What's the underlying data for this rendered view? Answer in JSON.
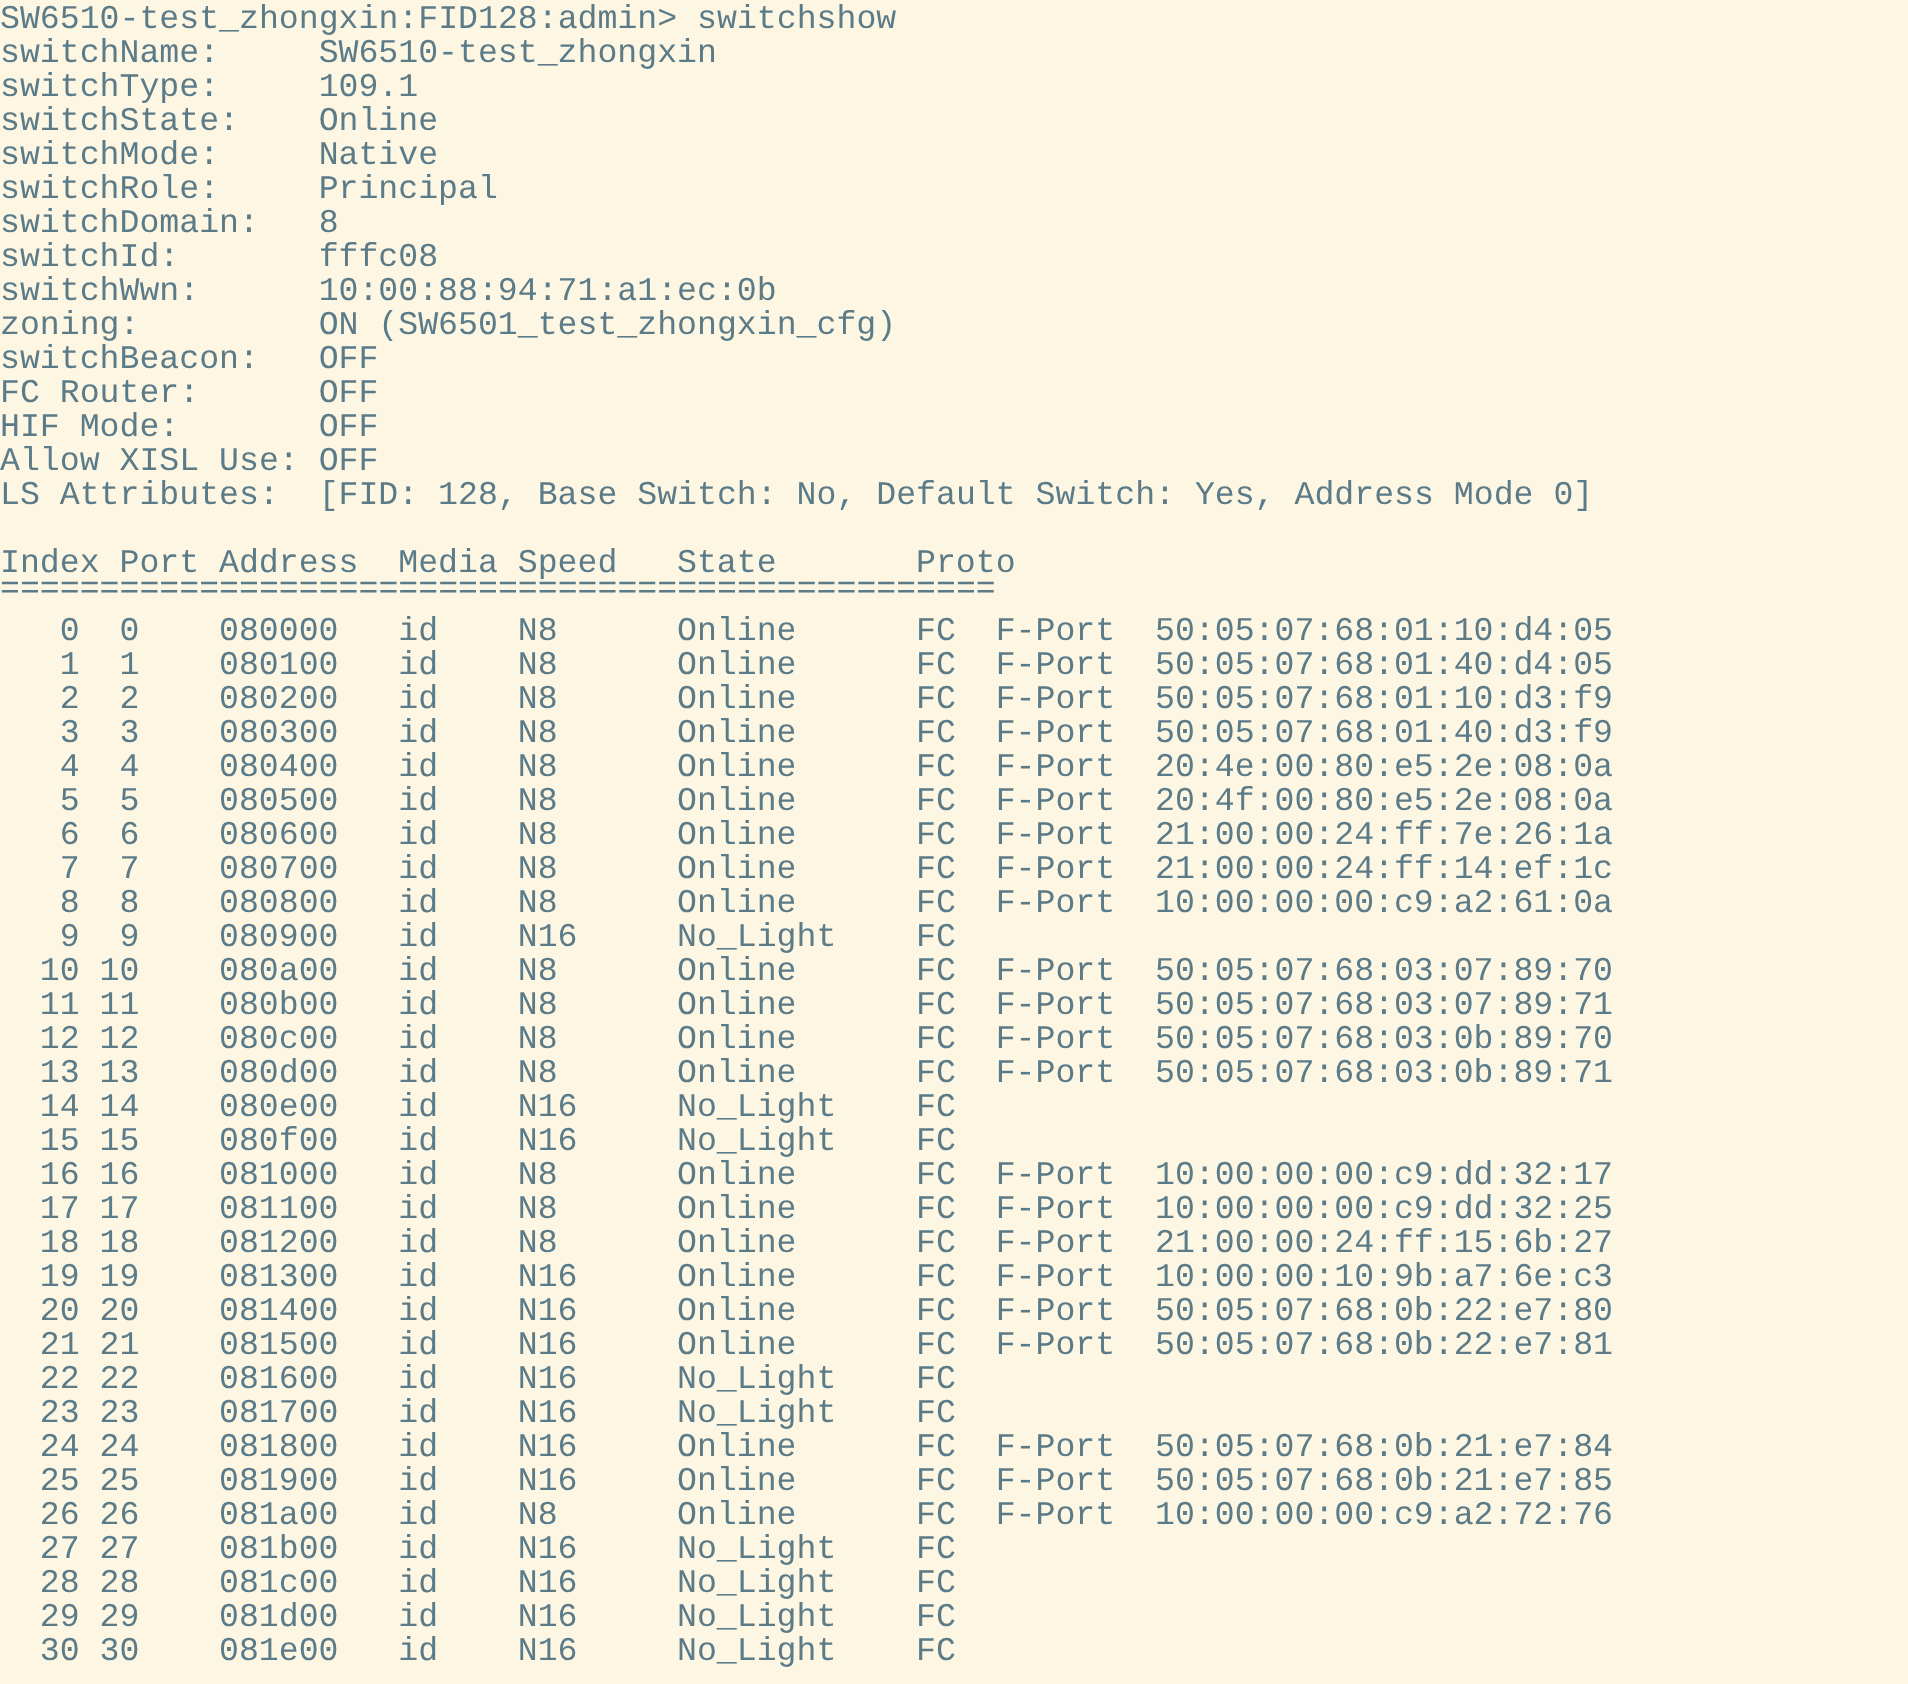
{
  "prompt": "SW6510-test_zhongxin:FID128:admin> switchshow",
  "fields": [
    {
      "label": "switchName:",
      "value": "SW6510-test_zhongxin"
    },
    {
      "label": "switchType:",
      "value": "109.1"
    },
    {
      "label": "switchState:",
      "value": "Online"
    },
    {
      "label": "switchMode:",
      "value": "Native"
    },
    {
      "label": "switchRole:",
      "value": "Principal"
    },
    {
      "label": "switchDomain:",
      "value": "8"
    },
    {
      "label": "switchId:",
      "value": "fffc08"
    },
    {
      "label": "switchWwn:",
      "value": "10:00:88:94:71:a1:ec:0b"
    },
    {
      "label": "zoning:",
      "value": "ON (SW6501_test_zhongxin_cfg)"
    },
    {
      "label": "switchBeacon:",
      "value": "OFF"
    },
    {
      "label": "FC Router:",
      "value": "OFF"
    },
    {
      "label": "HIF Mode:",
      "value": "OFF"
    },
    {
      "label": "Allow XISL Use:",
      "value": "OFF"
    },
    {
      "label": "LS Attributes:",
      "value": "[FID: 128, Base Switch: No, Default Switch: Yes, Address Mode 0]"
    }
  ],
  "table": {
    "columns": [
      "Index",
      "Port",
      "Address",
      "Media",
      "Speed",
      "State",
      "Proto"
    ],
    "separator": "==================================================",
    "rows": [
      {
        "index": "0",
        "port": "0",
        "address": "080000",
        "media": "id",
        "speed": "N8",
        "state": "Online",
        "proto": "FC",
        "port_type": "F-Port",
        "wwn": "50:05:07:68:01:10:d4:05"
      },
      {
        "index": "1",
        "port": "1",
        "address": "080100",
        "media": "id",
        "speed": "N8",
        "state": "Online",
        "proto": "FC",
        "port_type": "F-Port",
        "wwn": "50:05:07:68:01:40:d4:05"
      },
      {
        "index": "2",
        "port": "2",
        "address": "080200",
        "media": "id",
        "speed": "N8",
        "state": "Online",
        "proto": "FC",
        "port_type": "F-Port",
        "wwn": "50:05:07:68:01:10:d3:f9"
      },
      {
        "index": "3",
        "port": "3",
        "address": "080300",
        "media": "id",
        "speed": "N8",
        "state": "Online",
        "proto": "FC",
        "port_type": "F-Port",
        "wwn": "50:05:07:68:01:40:d3:f9"
      },
      {
        "index": "4",
        "port": "4",
        "address": "080400",
        "media": "id",
        "speed": "N8",
        "state": "Online",
        "proto": "FC",
        "port_type": "F-Port",
        "wwn": "20:4e:00:80:e5:2e:08:0a"
      },
      {
        "index": "5",
        "port": "5",
        "address": "080500",
        "media": "id",
        "speed": "N8",
        "state": "Online",
        "proto": "FC",
        "port_type": "F-Port",
        "wwn": "20:4f:00:80:e5:2e:08:0a"
      },
      {
        "index": "6",
        "port": "6",
        "address": "080600",
        "media": "id",
        "speed": "N8",
        "state": "Online",
        "proto": "FC",
        "port_type": "F-Port",
        "wwn": "21:00:00:24:ff:7e:26:1a"
      },
      {
        "index": "7",
        "port": "7",
        "address": "080700",
        "media": "id",
        "speed": "N8",
        "state": "Online",
        "proto": "FC",
        "port_type": "F-Port",
        "wwn": "21:00:00:24:ff:14:ef:1c"
      },
      {
        "index": "8",
        "port": "8",
        "address": "080800",
        "media": "id",
        "speed": "N8",
        "state": "Online",
        "proto": "FC",
        "port_type": "F-Port",
        "wwn": "10:00:00:00:c9:a2:61:0a"
      },
      {
        "index": "9",
        "port": "9",
        "address": "080900",
        "media": "id",
        "speed": "N16",
        "state": "No_Light",
        "proto": "FC"
      },
      {
        "index": "10",
        "port": "10",
        "address": "080a00",
        "media": "id",
        "speed": "N8",
        "state": "Online",
        "proto": "FC",
        "port_type": "F-Port",
        "wwn": "50:05:07:68:03:07:89:70"
      },
      {
        "index": "11",
        "port": "11",
        "address": "080b00",
        "media": "id",
        "speed": "N8",
        "state": "Online",
        "proto": "FC",
        "port_type": "F-Port",
        "wwn": "50:05:07:68:03:07:89:71"
      },
      {
        "index": "12",
        "port": "12",
        "address": "080c00",
        "media": "id",
        "speed": "N8",
        "state": "Online",
        "proto": "FC",
        "port_type": "F-Port",
        "wwn": "50:05:07:68:03:0b:89:70"
      },
      {
        "index": "13",
        "port": "13",
        "address": "080d00",
        "media": "id",
        "speed": "N8",
        "state": "Online",
        "proto": "FC",
        "port_type": "F-Port",
        "wwn": "50:05:07:68:03:0b:89:71"
      },
      {
        "index": "14",
        "port": "14",
        "address": "080e00",
        "media": "id",
        "speed": "N16",
        "state": "No_Light",
        "proto": "FC"
      },
      {
        "index": "15",
        "port": "15",
        "address": "080f00",
        "media": "id",
        "speed": "N16",
        "state": "No_Light",
        "proto": "FC"
      },
      {
        "index": "16",
        "port": "16",
        "address": "081000",
        "media": "id",
        "speed": "N8",
        "state": "Online",
        "proto": "FC",
        "port_type": "F-Port",
        "wwn": "10:00:00:00:c9:dd:32:17"
      },
      {
        "index": "17",
        "port": "17",
        "address": "081100",
        "media": "id",
        "speed": "N8",
        "state": "Online",
        "proto": "FC",
        "port_type": "F-Port",
        "wwn": "10:00:00:00:c9:dd:32:25"
      },
      {
        "index": "18",
        "port": "18",
        "address": "081200",
        "media": "id",
        "speed": "N8",
        "state": "Online",
        "proto": "FC",
        "port_type": "F-Port",
        "wwn": "21:00:00:24:ff:15:6b:27"
      },
      {
        "index": "19",
        "port": "19",
        "address": "081300",
        "media": "id",
        "speed": "N16",
        "state": "Online",
        "proto": "FC",
        "port_type": "F-Port",
        "wwn": "10:00:00:10:9b:a7:6e:c3"
      },
      {
        "index": "20",
        "port": "20",
        "address": "081400",
        "media": "id",
        "speed": "N16",
        "state": "Online",
        "proto": "FC",
        "port_type": "F-Port",
        "wwn": "50:05:07:68:0b:22:e7:80"
      },
      {
        "index": "21",
        "port": "21",
        "address": "081500",
        "media": "id",
        "speed": "N16",
        "state": "Online",
        "proto": "FC",
        "port_type": "F-Port",
        "wwn": "50:05:07:68:0b:22:e7:81"
      },
      {
        "index": "22",
        "port": "22",
        "address": "081600",
        "media": "id",
        "speed": "N16",
        "state": "No_Light",
        "proto": "FC"
      },
      {
        "index": "23",
        "port": "23",
        "address": "081700",
        "media": "id",
        "speed": "N16",
        "state": "No_Light",
        "proto": "FC"
      },
      {
        "index": "24",
        "port": "24",
        "address": "081800",
        "media": "id",
        "speed": "N16",
        "state": "Online",
        "proto": "FC",
        "port_type": "F-Port",
        "wwn": "50:05:07:68:0b:21:e7:84"
      },
      {
        "index": "25",
        "port": "25",
        "address": "081900",
        "media": "id",
        "speed": "N16",
        "state": "Online",
        "proto": "FC",
        "port_type": "F-Port",
        "wwn": "50:05:07:68:0b:21:e7:85"
      },
      {
        "index": "26",
        "port": "26",
        "address": "081a00",
        "media": "id",
        "speed": "N8",
        "state": "Online",
        "proto": "FC",
        "port_type": "F-Port",
        "wwn": "10:00:00:00:c9:a2:72:76"
      },
      {
        "index": "27",
        "port": "27",
        "address": "081b00",
        "media": "id",
        "speed": "N16",
        "state": "No_Light",
        "proto": "FC"
      },
      {
        "index": "28",
        "port": "28",
        "address": "081c00",
        "media": "id",
        "speed": "N16",
        "state": "No_Light",
        "proto": "FC"
      },
      {
        "index": "29",
        "port": "29",
        "address": "081d00",
        "media": "id",
        "speed": "N16",
        "state": "No_Light",
        "proto": "FC"
      },
      {
        "index": "30",
        "port": "30",
        "address": "081e00",
        "media": "id",
        "speed": "N16",
        "state": "No_Light",
        "proto": "FC"
      }
    ]
  }
}
